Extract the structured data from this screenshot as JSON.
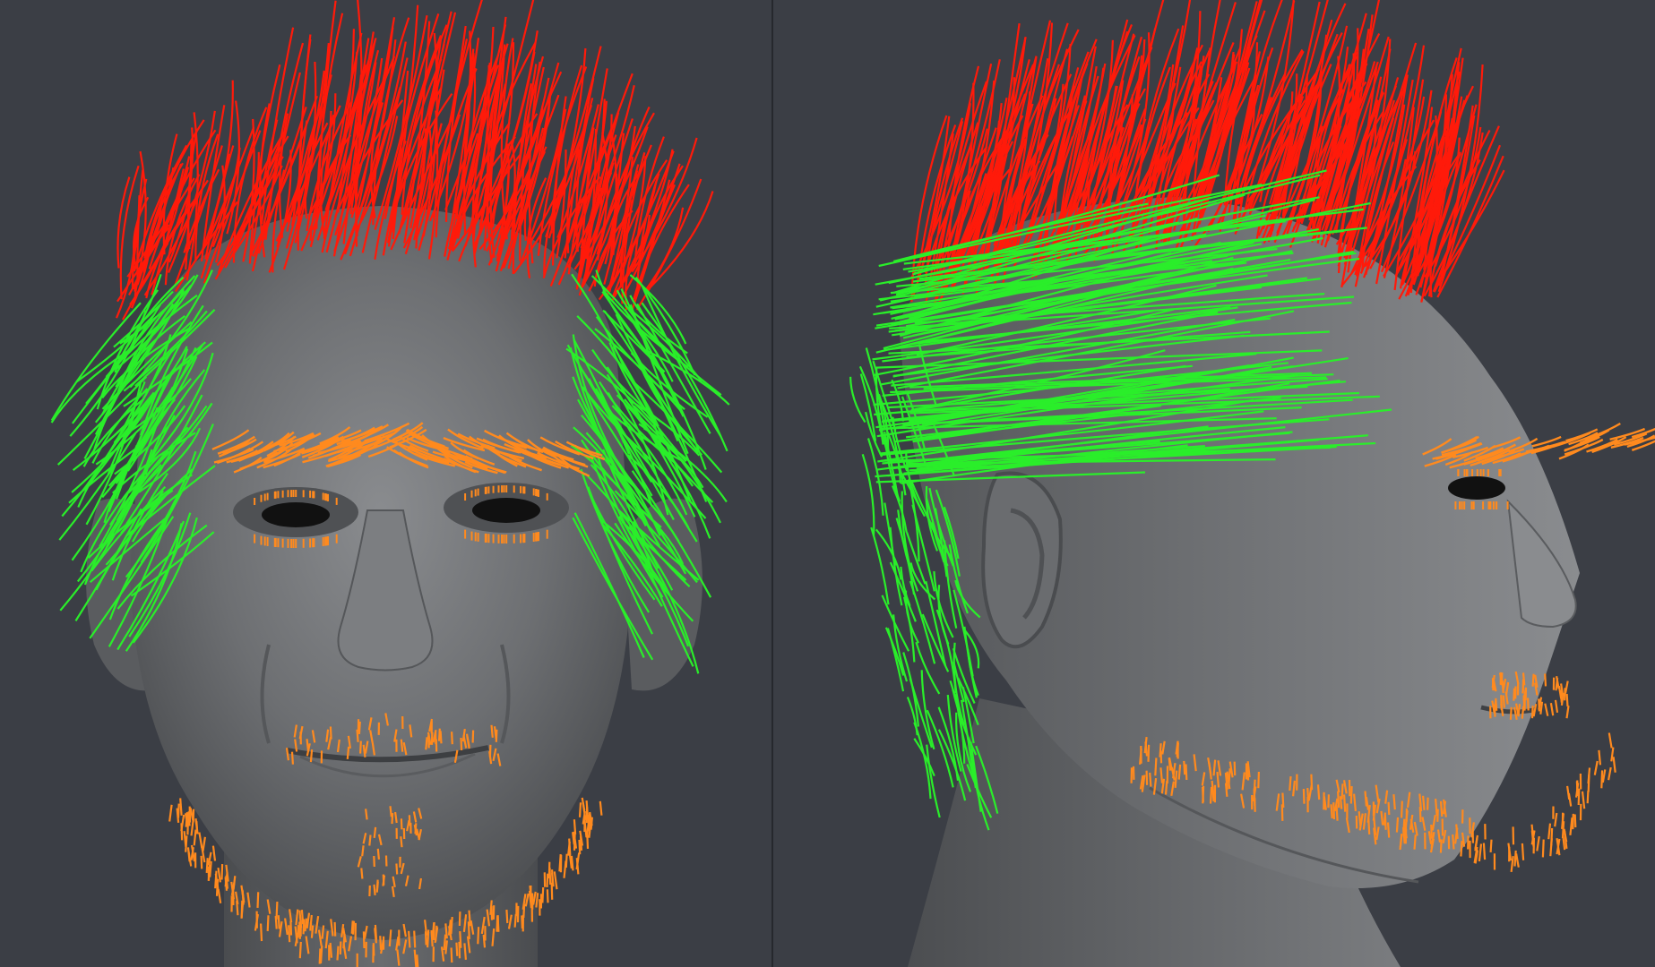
{
  "scene": {
    "background": "#3b3e45",
    "divider_color": "#26282d",
    "viewports": [
      {
        "id": "front",
        "view": "front"
      },
      {
        "id": "side",
        "view": "three-quarter-right"
      }
    ],
    "guide_groups": [
      {
        "id": "scalp",
        "color": "#ff1a0a",
        "kind": "long-strands"
      },
      {
        "id": "sides",
        "color": "#2aee2a",
        "kind": "long-strands"
      },
      {
        "id": "brows",
        "color": "#ff8a1e",
        "kind": "short-strands"
      },
      {
        "id": "lashes",
        "color": "#ff8a1e",
        "kind": "stubble"
      },
      {
        "id": "beard",
        "color": "#ff8a1e",
        "kind": "stubble"
      }
    ],
    "mesh_color": "#6b6d70"
  }
}
